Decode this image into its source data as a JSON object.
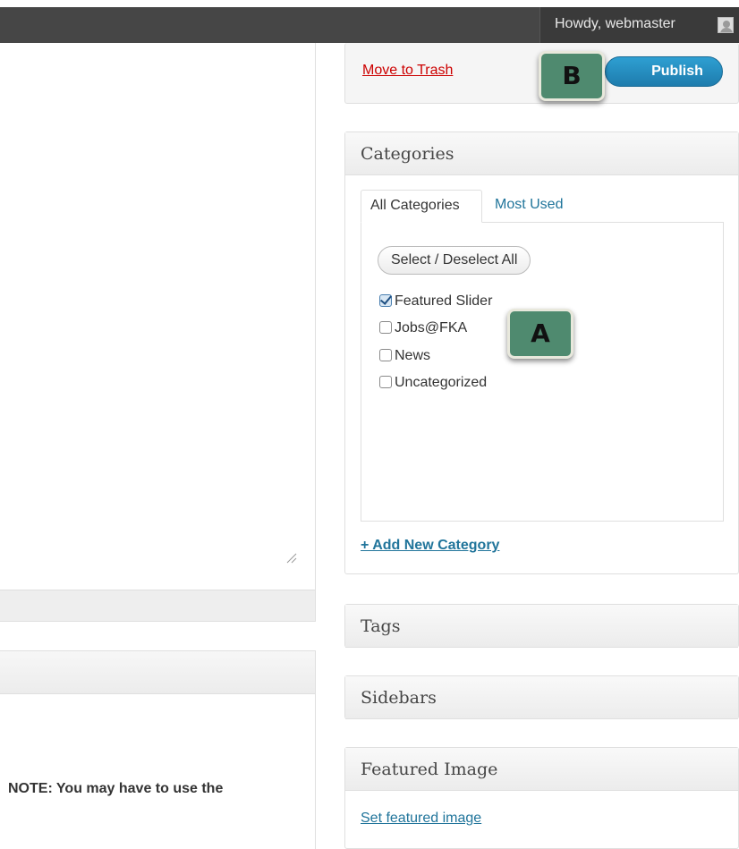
{
  "admin_bar": {
    "greeting": "Howdy, webmaster"
  },
  "editor": {
    "note_text": "NOTE: You may have to use the"
  },
  "publish": {
    "trash_label": "Move to Trash",
    "publish_label": "Publish"
  },
  "categories": {
    "title": "Categories",
    "tabs": [
      "All Categories",
      "Most Used"
    ],
    "select_all_label": "Select / Deselect All",
    "items": [
      {
        "label": "Featured Slider",
        "checked": true
      },
      {
        "label": "Jobs@FKA",
        "checked": false
      },
      {
        "label": "News",
        "checked": false
      },
      {
        "label": "Uncategorized",
        "checked": false
      }
    ],
    "add_new_label": "+ Add New Category"
  },
  "tags": {
    "title": "Tags"
  },
  "sidebars": {
    "title": "Sidebars"
  },
  "featured_image": {
    "title": "Featured Image",
    "set_label": "Set featured image"
  },
  "annotations": {
    "a": "A",
    "b": "B"
  },
  "colors": {
    "admin_bar": "#464646",
    "link_blue": "#21759b",
    "trash_red": "#cc0000",
    "publish_blue": "#2e9fd2",
    "badge_green": "#4f8a6f"
  }
}
